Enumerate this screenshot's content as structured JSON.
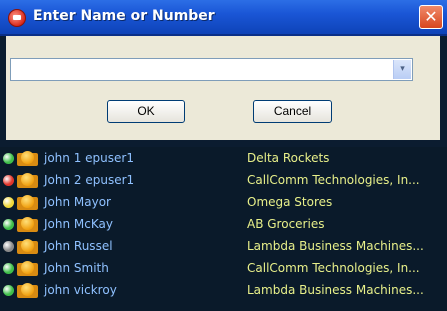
{
  "dialog": {
    "title": "Enter Name or Number",
    "close_glyph": "✕",
    "input_value": "",
    "dropdown_glyph": "▾",
    "ok_label": "OK",
    "cancel_label": "Cancel"
  },
  "contacts": [
    {
      "name": "john 1 epuser1",
      "company": "Delta Rockets",
      "status_color": "#3fbf4a"
    },
    {
      "name": "John 2 epuser1",
      "company": "CallComm Technologies, In...",
      "status_color": "#e2352a"
    },
    {
      "name": "John Mayor",
      "company": "Omega Stores",
      "status_color": "#f0d83a"
    },
    {
      "name": "John McKay",
      "company": "AB Groceries",
      "status_color": "#3fbf4a"
    },
    {
      "name": "John Russel",
      "company": "Lambda Business Machines...",
      "status_color": "#8a8a8a"
    },
    {
      "name": "John Smith",
      "company": "CallComm Technologies, In...",
      "status_color": "#3fbf4a"
    },
    {
      "name": "john vickroy",
      "company": "Lambda Business Machines...",
      "status_color": "#3fbf4a"
    }
  ]
}
